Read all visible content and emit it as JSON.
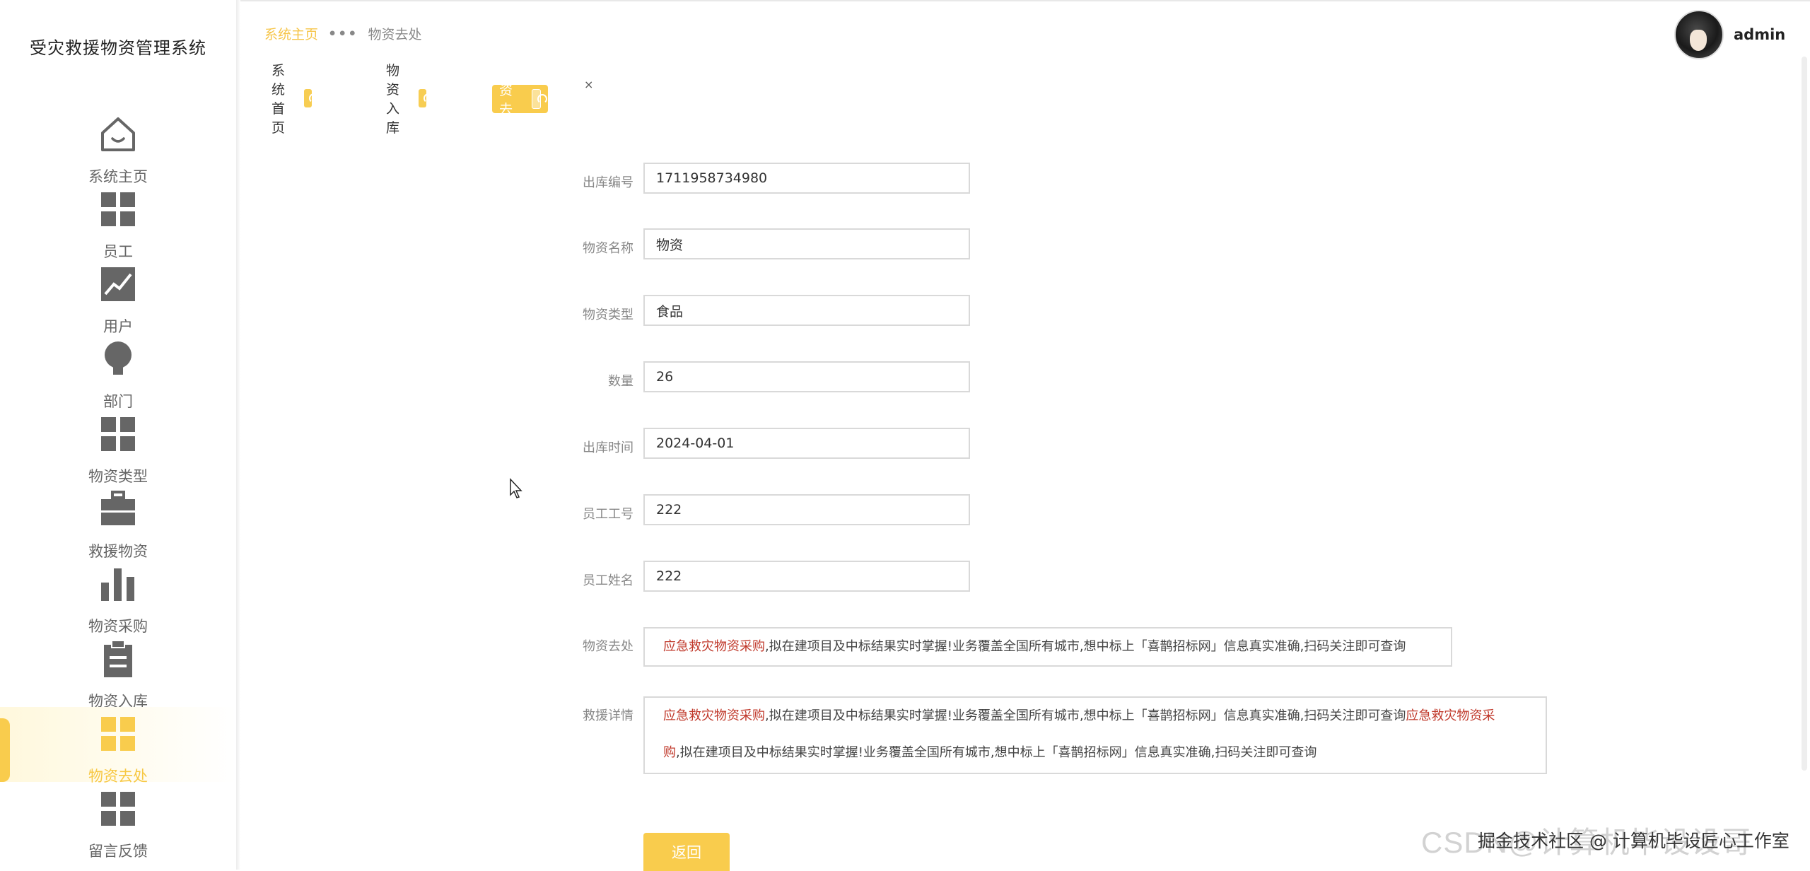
{
  "app": {
    "title": "受灾救援物资管理系统"
  },
  "sidebar": {
    "items": [
      {
        "label": "系统主页",
        "icon": "home-icon",
        "active": false
      },
      {
        "label": "员工",
        "icon": "grid-icon",
        "active": false
      },
      {
        "label": "用户",
        "icon": "chart-line-icon",
        "active": false
      },
      {
        "label": "部门",
        "icon": "bulb-icon",
        "active": false
      },
      {
        "label": "物资类型",
        "icon": "grid-icon",
        "active": false
      },
      {
        "label": "救援物资",
        "icon": "briefcase-icon",
        "active": false
      },
      {
        "label": "物资采购",
        "icon": "bar-chart-icon",
        "active": false
      },
      {
        "label": "物资入库",
        "icon": "clipboard-icon",
        "active": false
      },
      {
        "label": "物资去处",
        "icon": "grid-icon",
        "active": true
      },
      {
        "label": "留言反馈",
        "icon": "grid-icon",
        "active": false
      }
    ],
    "accent_color": "#f9cc4d"
  },
  "header": {
    "breadcrumb": {
      "home": "系统主页",
      "separator": "•••",
      "current": "物资去处"
    },
    "user": {
      "name": "admin"
    }
  },
  "tabs": [
    {
      "label": "系统首页",
      "closable": false,
      "active": false
    },
    {
      "label": "物资入库",
      "closable": true,
      "close_glyph": "×",
      "active": false
    },
    {
      "label": "物资去处",
      "closable": true,
      "close_glyph": "×",
      "active": true
    }
  ],
  "form": {
    "fields": [
      {
        "label": "出库编号",
        "value": "1711958734980"
      },
      {
        "label": "物资名称",
        "value": "物资"
      },
      {
        "label": "物资类型",
        "value": "食品"
      },
      {
        "label": "数量",
        "value": "26"
      },
      {
        "label": "出库时间",
        "value": "2024-04-01"
      },
      {
        "label": "员工工号",
        "value": "222"
      },
      {
        "label": "员工姓名",
        "value": "222"
      }
    ],
    "destination": {
      "label": "物资去处",
      "link_text": "应急救灾物资采购",
      "text": ",拟在建项目及中标结果实时掌握!业务覆盖全国所有城市,想中标上「喜鹊招标网」信息真实准确,扫码关注即可查询"
    },
    "details": {
      "label": "救援详情",
      "link_text_1": "应急救灾物资采购",
      "text_1": ",拟在建项目及中标结果实时掌握!业务覆盖全国所有城市,想中标上「喜鹊招标网」信息真实准确,扫码关注即可查询",
      "link_text_2a": "应急救灾物资采",
      "link_text_2b": "购",
      "text_2": ",拟在建项目及中标结果实时掌握!业务覆盖全国所有城市,想中标上「喜鹊招标网」信息真实准确,扫码关注即可查询"
    },
    "back_button": "返回"
  },
  "watermark": {
    "brand": "CSDN@计算机毕设设哥",
    "sub": "掘金技术社区 @ 计算机毕设匠心工作室"
  }
}
